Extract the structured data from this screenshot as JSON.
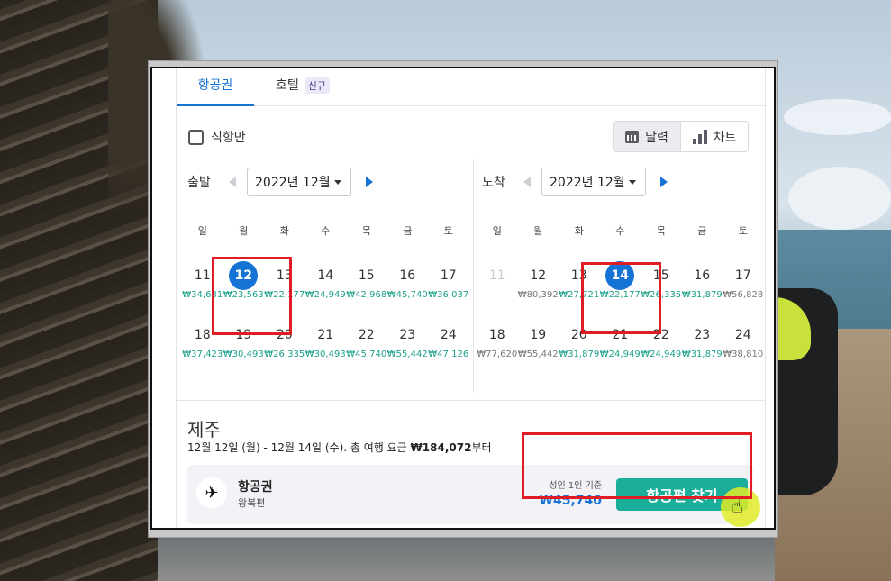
{
  "tabs": {
    "flights": "항공권",
    "hotels": "호텔",
    "hotels_badge": "신규"
  },
  "filters": {
    "direct_only": "직항만"
  },
  "view_toggle": {
    "calendar": "달력",
    "chart": "차트"
  },
  "depart": {
    "label": "출발",
    "month": "2022년 12월",
    "weekdays": [
      "일",
      "월",
      "화",
      "수",
      "목",
      "금",
      "토"
    ],
    "weeks": [
      [
        {
          "d": "11",
          "p": "₩34,631"
        },
        {
          "d": "12",
          "p": "₩23,563",
          "sel": true
        },
        {
          "d": "13",
          "p": "₩22,177"
        },
        {
          "d": "14",
          "p": "₩24,949"
        },
        {
          "d": "15",
          "p": "₩42,968"
        },
        {
          "d": "16",
          "p": "₩45,740"
        },
        {
          "d": "17",
          "p": "₩36,037"
        }
      ],
      [
        {
          "d": "18",
          "p": "₩37,423"
        },
        {
          "d": "19",
          "p": "₩30,493"
        },
        {
          "d": "20",
          "p": "₩26,335"
        },
        {
          "d": "21",
          "p": "₩30,493"
        },
        {
          "d": "22",
          "p": "₩45,740"
        },
        {
          "d": "23",
          "p": "₩55,442"
        },
        {
          "d": "24",
          "p": "₩47,126"
        }
      ]
    ]
  },
  "arrive": {
    "label": "도착",
    "month": "2022년 12월",
    "weekdays": [
      "일",
      "월",
      "화",
      "수",
      "목",
      "금",
      "토"
    ],
    "weeks": [
      [
        {
          "d": "11",
          "p": "",
          "muted": true
        },
        {
          "d": "12",
          "p": "₩80,392",
          "gray": true
        },
        {
          "d": "13",
          "p": "₩27,721"
        },
        {
          "d": "14",
          "p": "₩22,177",
          "sel": true
        },
        {
          "d": "15",
          "p": "₩26,335"
        },
        {
          "d": "16",
          "p": "₩31,879"
        },
        {
          "d": "17",
          "p": "₩56,828",
          "gray": true
        }
      ],
      [
        {
          "d": "18",
          "p": "₩77,620",
          "gray": true
        },
        {
          "d": "19",
          "p": "₩55,442",
          "gray": true
        },
        {
          "d": "20",
          "p": "₩31,879"
        },
        {
          "d": "21",
          "p": "₩24,949"
        },
        {
          "d": "22",
          "p": "₩24,949"
        },
        {
          "d": "23",
          "p": "₩31,879"
        },
        {
          "d": "24",
          "p": "₩38,810",
          "gray": true
        }
      ]
    ]
  },
  "summary": {
    "destination": "제주",
    "trip_text": "12월 12일 (월) - 12월 14일 (수). 총 여행 요금 ",
    "trip_total": "₩184,072",
    "trip_suffix": "부터",
    "card_title": "항공권",
    "card_sub": "왕복편",
    "per_adult": "성인 1인 기준",
    "price": "₩45,740",
    "search_button": "항공편 찾기"
  },
  "colors": {
    "accent": "#1573d6",
    "price_green": "#1aa08a",
    "button": "#1aae9b",
    "highlight": "#e01c24"
  }
}
